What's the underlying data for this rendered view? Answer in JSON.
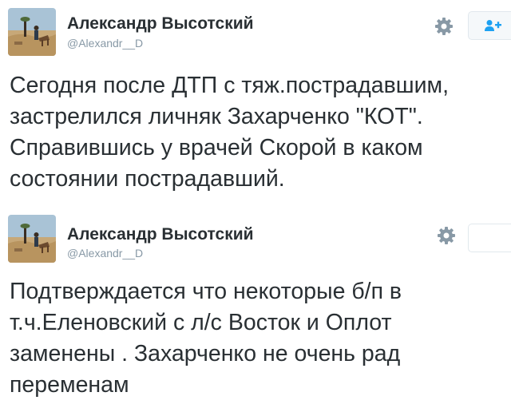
{
  "tweets": [
    {
      "author": {
        "name": "Александр Высотский",
        "handle": "@Alexandr__D"
      },
      "text": "Сегодня после ДТП с тяж.пострадавшим,\nзастрелился личняк Захарченко \"КОТ\".\nСправившись у врачей Скорой в каком\nсостоянии пострадавший.",
      "actions": {
        "settings_icon": "gear-icon",
        "follow_icon": "add-user-icon"
      }
    },
    {
      "author": {
        "name": "Александр Высотский",
        "handle": "@Alexandr__D"
      },
      "text": "Подтверждается что некоторые б/п в\nт.ч.Еленовский  с л/с Восток и Оплот\nзаменены . Захарченко не очень рад\nпеременам",
      "actions": {
        "settings_icon": "gear-icon"
      }
    }
  ],
  "colors": {
    "name": "#292f33",
    "handle": "#8899a6",
    "text": "#292f33",
    "follow_icon": "#1da1f2",
    "gear": "#8899a6"
  }
}
